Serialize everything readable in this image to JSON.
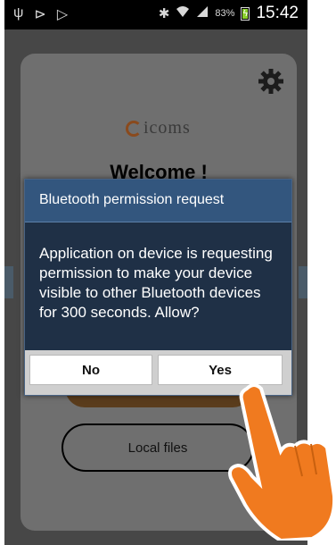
{
  "status_bar": {
    "left_icons": [
      "usb-icon",
      "cast-icon",
      "play-store-icon"
    ],
    "right_icons": [
      "bluetooth-icon",
      "wifi-icon",
      "signal-icon"
    ],
    "battery_percent": "83%",
    "battery_level": 0.83,
    "time": "15:42"
  },
  "app": {
    "logo_text": "icoms",
    "welcome": "Welcome !",
    "local_files_label": "Local files",
    "settings_icon": "gear-icon"
  },
  "dialog": {
    "title": "Bluetooth permission request",
    "message": "Application on device is requesting permission to make your device visible to other Bluetooth devices for 300 seconds. Allow?",
    "no_label": "No",
    "yes_label": "Yes"
  },
  "colors": {
    "dialog_title_bg": "#33567e",
    "dialog_body_bg": "#1f3046",
    "hand": "#f07a1f",
    "accent": "#8a4a1d"
  }
}
